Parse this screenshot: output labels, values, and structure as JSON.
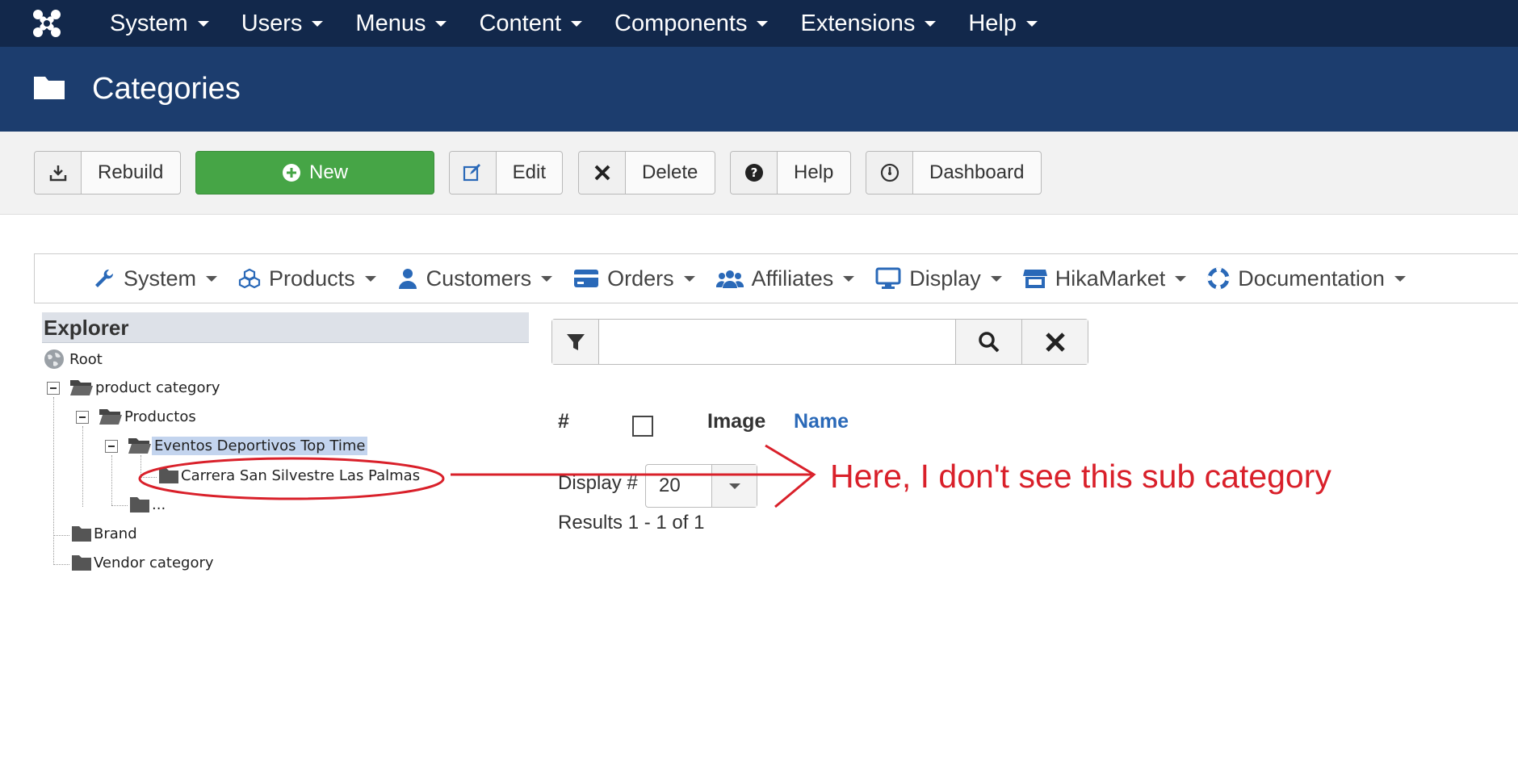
{
  "topnav": {
    "items": [
      {
        "label": "System"
      },
      {
        "label": "Users"
      },
      {
        "label": "Menus"
      },
      {
        "label": "Content"
      },
      {
        "label": "Components"
      },
      {
        "label": "Extensions"
      },
      {
        "label": "Help"
      }
    ]
  },
  "header": {
    "title": "Categories"
  },
  "toolbar": {
    "rebuild": "Rebuild",
    "new": "New",
    "edit": "Edit",
    "delete": "Delete",
    "help": "Help",
    "dashboard": "Dashboard"
  },
  "submenu": {
    "items": [
      {
        "label": "System",
        "icon": "wrench-icon"
      },
      {
        "label": "Products",
        "icon": "cubes-icon"
      },
      {
        "label": "Customers",
        "icon": "user-icon"
      },
      {
        "label": "Orders",
        "icon": "credit-card-icon"
      },
      {
        "label": "Affiliates",
        "icon": "users-icon"
      },
      {
        "label": "Display",
        "icon": "monitor-icon"
      },
      {
        "label": "HikaMarket",
        "icon": "store-icon"
      },
      {
        "label": "Documentation",
        "icon": "lifebuoy-icon"
      }
    ]
  },
  "explorer": {
    "title": "Explorer",
    "nodes": [
      {
        "label": "Root"
      },
      {
        "label": "product category"
      },
      {
        "label": "Productos"
      },
      {
        "label": "Eventos Deportivos Top Time",
        "selected": true
      },
      {
        "label": "Carrera San Silvestre Las Palmas"
      },
      {
        "label": "..."
      },
      {
        "label": "Brand"
      },
      {
        "label": "Vendor category"
      }
    ]
  },
  "search": {
    "value": "",
    "placeholder": ""
  },
  "table": {
    "col_num": "#",
    "col_image": "Image",
    "col_name": "Name"
  },
  "pagination": {
    "display_label": "Display #",
    "display_value": "20",
    "results": "Results 1 - 1 of 1"
  },
  "annotation": {
    "text": "Here, I don't see this sub category",
    "color": "#d9202a"
  },
  "colors": {
    "topbar": "#12284b",
    "header": "#1c3d6e",
    "new_button": "#46a546",
    "link": "#2a69b8"
  }
}
